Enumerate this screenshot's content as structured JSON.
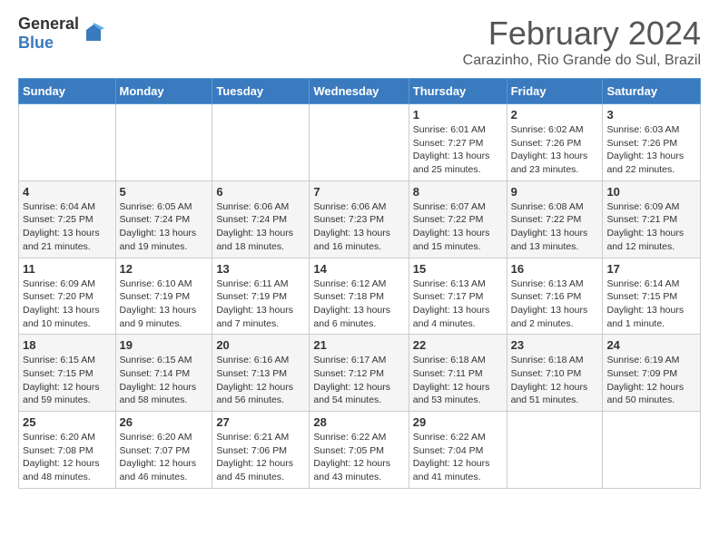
{
  "header": {
    "logo_general": "General",
    "logo_blue": "Blue",
    "month_year": "February 2024",
    "location": "Carazinho, Rio Grande do Sul, Brazil"
  },
  "days_of_week": [
    "Sunday",
    "Monday",
    "Tuesday",
    "Wednesday",
    "Thursday",
    "Friday",
    "Saturday"
  ],
  "weeks": [
    [
      {
        "day": "",
        "info": ""
      },
      {
        "day": "",
        "info": ""
      },
      {
        "day": "",
        "info": ""
      },
      {
        "day": "",
        "info": ""
      },
      {
        "day": "1",
        "info": "Sunrise: 6:01 AM\nSunset: 7:27 PM\nDaylight: 13 hours\nand 25 minutes."
      },
      {
        "day": "2",
        "info": "Sunrise: 6:02 AM\nSunset: 7:26 PM\nDaylight: 13 hours\nand 23 minutes."
      },
      {
        "day": "3",
        "info": "Sunrise: 6:03 AM\nSunset: 7:26 PM\nDaylight: 13 hours\nand 22 minutes."
      }
    ],
    [
      {
        "day": "4",
        "info": "Sunrise: 6:04 AM\nSunset: 7:25 PM\nDaylight: 13 hours\nand 21 minutes."
      },
      {
        "day": "5",
        "info": "Sunrise: 6:05 AM\nSunset: 7:24 PM\nDaylight: 13 hours\nand 19 minutes."
      },
      {
        "day": "6",
        "info": "Sunrise: 6:06 AM\nSunset: 7:24 PM\nDaylight: 13 hours\nand 18 minutes."
      },
      {
        "day": "7",
        "info": "Sunrise: 6:06 AM\nSunset: 7:23 PM\nDaylight: 13 hours\nand 16 minutes."
      },
      {
        "day": "8",
        "info": "Sunrise: 6:07 AM\nSunset: 7:22 PM\nDaylight: 13 hours\nand 15 minutes."
      },
      {
        "day": "9",
        "info": "Sunrise: 6:08 AM\nSunset: 7:22 PM\nDaylight: 13 hours\nand 13 minutes."
      },
      {
        "day": "10",
        "info": "Sunrise: 6:09 AM\nSunset: 7:21 PM\nDaylight: 13 hours\nand 12 minutes."
      }
    ],
    [
      {
        "day": "11",
        "info": "Sunrise: 6:09 AM\nSunset: 7:20 PM\nDaylight: 13 hours\nand 10 minutes."
      },
      {
        "day": "12",
        "info": "Sunrise: 6:10 AM\nSunset: 7:19 PM\nDaylight: 13 hours\nand 9 minutes."
      },
      {
        "day": "13",
        "info": "Sunrise: 6:11 AM\nSunset: 7:19 PM\nDaylight: 13 hours\nand 7 minutes."
      },
      {
        "day": "14",
        "info": "Sunrise: 6:12 AM\nSunset: 7:18 PM\nDaylight: 13 hours\nand 6 minutes."
      },
      {
        "day": "15",
        "info": "Sunrise: 6:13 AM\nSunset: 7:17 PM\nDaylight: 13 hours\nand 4 minutes."
      },
      {
        "day": "16",
        "info": "Sunrise: 6:13 AM\nSunset: 7:16 PM\nDaylight: 13 hours\nand 2 minutes."
      },
      {
        "day": "17",
        "info": "Sunrise: 6:14 AM\nSunset: 7:15 PM\nDaylight: 13 hours\nand 1 minute."
      }
    ],
    [
      {
        "day": "18",
        "info": "Sunrise: 6:15 AM\nSunset: 7:15 PM\nDaylight: 12 hours\nand 59 minutes."
      },
      {
        "day": "19",
        "info": "Sunrise: 6:15 AM\nSunset: 7:14 PM\nDaylight: 12 hours\nand 58 minutes."
      },
      {
        "day": "20",
        "info": "Sunrise: 6:16 AM\nSunset: 7:13 PM\nDaylight: 12 hours\nand 56 minutes."
      },
      {
        "day": "21",
        "info": "Sunrise: 6:17 AM\nSunset: 7:12 PM\nDaylight: 12 hours\nand 54 minutes."
      },
      {
        "day": "22",
        "info": "Sunrise: 6:18 AM\nSunset: 7:11 PM\nDaylight: 12 hours\nand 53 minutes."
      },
      {
        "day": "23",
        "info": "Sunrise: 6:18 AM\nSunset: 7:10 PM\nDaylight: 12 hours\nand 51 minutes."
      },
      {
        "day": "24",
        "info": "Sunrise: 6:19 AM\nSunset: 7:09 PM\nDaylight: 12 hours\nand 50 minutes."
      }
    ],
    [
      {
        "day": "25",
        "info": "Sunrise: 6:20 AM\nSunset: 7:08 PM\nDaylight: 12 hours\nand 48 minutes."
      },
      {
        "day": "26",
        "info": "Sunrise: 6:20 AM\nSunset: 7:07 PM\nDaylight: 12 hours\nand 46 minutes."
      },
      {
        "day": "27",
        "info": "Sunrise: 6:21 AM\nSunset: 7:06 PM\nDaylight: 12 hours\nand 45 minutes."
      },
      {
        "day": "28",
        "info": "Sunrise: 6:22 AM\nSunset: 7:05 PM\nDaylight: 12 hours\nand 43 minutes."
      },
      {
        "day": "29",
        "info": "Sunrise: 6:22 AM\nSunset: 7:04 PM\nDaylight: 12 hours\nand 41 minutes."
      },
      {
        "day": "",
        "info": ""
      },
      {
        "day": "",
        "info": ""
      }
    ]
  ]
}
